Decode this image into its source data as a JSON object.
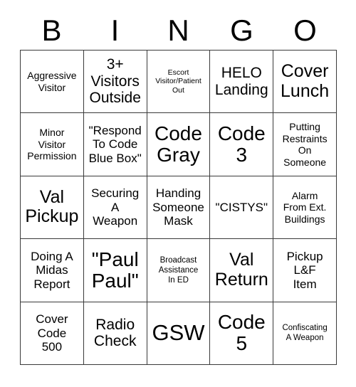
{
  "card": {
    "title_letters": [
      "B",
      "I",
      "N",
      "G",
      "O"
    ],
    "columns": 5,
    "rows": 5,
    "colors": {
      "background": "#ffffff",
      "text": "#000000",
      "grid_line": "#3a3a3a"
    },
    "cells": [
      [
        {
          "text": "Aggressive\nVisitor",
          "size": "m"
        },
        {
          "text": "3+\nVisitors\nOutside",
          "size": "xl"
        },
        {
          "text": "Escort\nVisitor/Patient\nOut",
          "size": "xs"
        },
        {
          "text": "HELO\nLanding",
          "size": "xl"
        },
        {
          "text": "Cover\nLunch",
          "size": "xxl"
        }
      ],
      [
        {
          "text": "Minor\nVisitor\nPermission",
          "size": "m"
        },
        {
          "text": "\"Respond\nTo Code\nBlue Box\"",
          "size": "l"
        },
        {
          "text": "Code\nGray",
          "size": "h"
        },
        {
          "text": "Code\n3",
          "size": "h"
        },
        {
          "text": "Putting\nRestraints\nOn\nSomeone",
          "size": "m"
        }
      ],
      [
        {
          "text": "Val\nPickup",
          "size": "xxl"
        },
        {
          "text": "Securing\nA\nWeapon",
          "size": "l"
        },
        {
          "text": "Handing\nSomeone\nMask",
          "size": "l"
        },
        {
          "text": "\"CISTYS\"",
          "size": "l"
        },
        {
          "text": "Alarm\nFrom Ext.\nBuildings",
          "size": "m"
        }
      ],
      [
        {
          "text": "Doing A\nMidas\nReport",
          "size": "l"
        },
        {
          "text": "\"Paul\nPaul\"",
          "size": "h"
        },
        {
          "text": "Broadcast\nAssistance\nIn ED",
          "size": "s"
        },
        {
          "text": "Val\nReturn",
          "size": "xxl"
        },
        {
          "text": "Pickup\nL&F\nItem",
          "size": "l"
        }
      ],
      [
        {
          "text": "Cover\nCode\n500",
          "size": "l"
        },
        {
          "text": "Radio\nCheck",
          "size": "xl"
        },
        {
          "text": "GSW",
          "size": "hh"
        },
        {
          "text": "Code\n5",
          "size": "h"
        },
        {
          "text": "Confiscating\nA Weapon",
          "size": "s"
        }
      ]
    ]
  }
}
